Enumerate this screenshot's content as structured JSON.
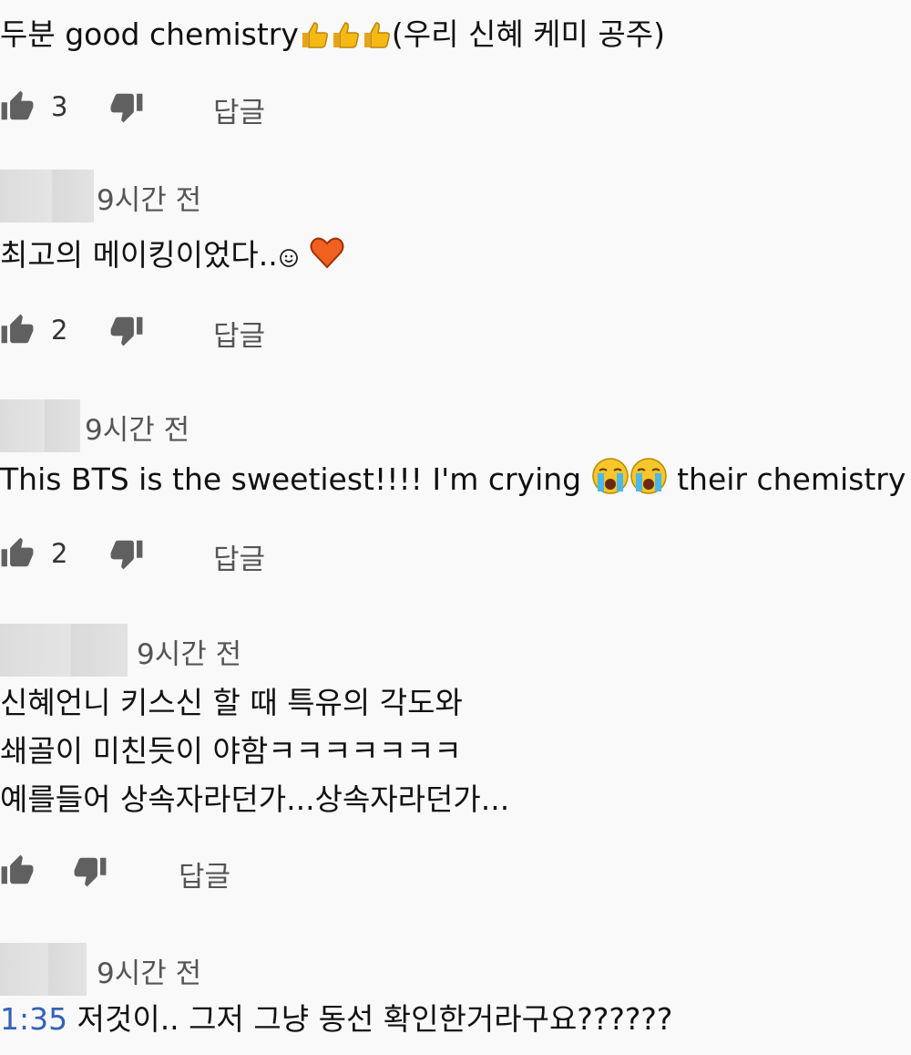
{
  "comments": [
    {
      "time": "",
      "text_lines": [
        "두분 good  chemistry",
        "(우리 신혜 케미 공주)"
      ],
      "likes": "3",
      "reply_label": "답글"
    },
    {
      "time": "9시간 전",
      "text_lines": [
        "최고의 메이킹이었다.."
      ],
      "likes": "2",
      "reply_label": "답글"
    },
    {
      "time": "9시간 전",
      "text_lines": [
        "This BTS is the sweetiest!!!! I'm crying",
        "their chemistry is"
      ],
      "likes": "2",
      "reply_label": "답글"
    },
    {
      "time": "9시간 전",
      "text_lines": [
        "신혜언니 키스신 할 때 특유의 각도와",
        "쇄골이 미친듯이 야함ㅋㅋㅋㅋㅋㅋㅋ",
        "예를들어 상속자라던가...상속자라던가..."
      ],
      "likes": "",
      "reply_label": "답글"
    },
    {
      "time": "9시간 전",
      "timestamp_link": "1:35",
      "text_lines": [
        "저것이.. 그저 그냥 동선 확인한거라구요??????"
      ]
    }
  ],
  "colors": {
    "background": "#f9f9f9",
    "text": "#111111",
    "meta": "#555555",
    "link": "#3262b8",
    "icon": "#606060"
  },
  "icons": [
    "thumbs-up-icon",
    "thumbs-down-icon",
    "thumbs-up-emoji",
    "smiley-emoji",
    "orange-heart-emoji",
    "crying-face-emoji"
  ]
}
